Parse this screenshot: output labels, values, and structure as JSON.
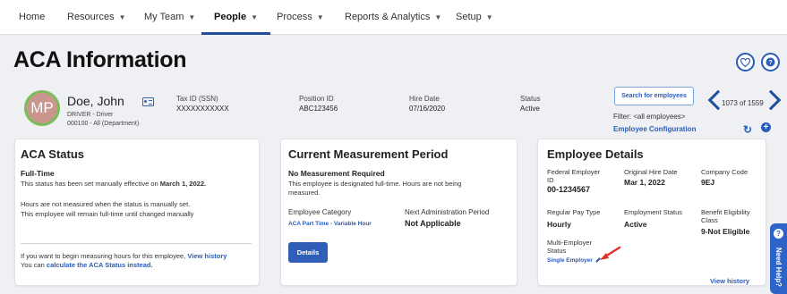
{
  "nav": [
    {
      "label": "Home",
      "caret": false,
      "active": false
    },
    {
      "label": "Resources",
      "caret": true,
      "active": false
    },
    {
      "label": "My Team",
      "caret": true,
      "active": false
    },
    {
      "label": "People",
      "caret": true,
      "active": true
    },
    {
      "label": "Process",
      "caret": true,
      "active": false
    },
    {
      "label": "Reports & Analytics",
      "caret": true,
      "active": false
    },
    {
      "label": "Setup",
      "caret": true,
      "active": false
    }
  ],
  "page_title": "ACA Information",
  "header_icons": {
    "favorite": "heart-icon",
    "help": "help-icon"
  },
  "employee": {
    "initials": "MP",
    "name": "Doe, John",
    "title": "DRIVER - Driver",
    "department": "000100 - All (Department)",
    "tax_id_label": "Tax ID (SSN)",
    "tax_id": "XXXXXXXXXXX",
    "position_id_label": "Position ID",
    "position_id": "ABC123456",
    "hire_date_label": "Hire Date",
    "hire_date": "07/16/2020",
    "status_label": "Status",
    "status": "Active"
  },
  "search": {
    "button_label": "Search for employees",
    "filter_text": "Filter: <all employees>",
    "config_link": "Employee Configuration",
    "counter": "1073 of 1559"
  },
  "aca_status": {
    "title": "ACA Status",
    "status": "Full-Time",
    "set_text_prefix": "This status has been set manually effective on ",
    "set_date": "March 1, 2022.",
    "line1": "Hours are not measured when the status is manually set.",
    "line2": "This employee will remain full-time until changed manually",
    "footer_text": "If you want to begin measuring hours for this employee,",
    "view_history": "View history",
    "footer2_prefix": "You can ",
    "calc_link": "calculate the ACA Status instead."
  },
  "measurement": {
    "title": "Current Measurement Period",
    "heading": "No Measurement Required",
    "desc1": "This employee is designated full-time. Hours are not being",
    "desc2": "measured.",
    "category_label": "Employee Category",
    "category_value": "ACA Part Time - Variable Hour",
    "next_period_label": "Next Administration Period",
    "next_period_value": "Not Applicable",
    "details_button": "Details"
  },
  "employee_details": {
    "title": "Employee Details",
    "fein_label_1": "Federal Employer",
    "fein_label_2": "ID",
    "fein_value": "00-1234567",
    "orig_hire_label": "Original Hire Date",
    "orig_hire_value": "Mar 1, 2022",
    "company_code_label": "Company Code",
    "company_code_value": "9EJ",
    "pay_type_label": "Regular Pay Type",
    "pay_type_value": "Hourly",
    "emp_status_label": "Employment Status",
    "emp_status_value": "Active",
    "benefit_label_1": "Benefit Eligibility",
    "benefit_label_2": "Class",
    "benefit_value": "9-Not Eligible",
    "multi_label_1": "Multi-Employer",
    "multi_label_2": "Status",
    "multi_value": "Single Employer",
    "view_history": "View history"
  },
  "help_tab": {
    "label": "Need Help?"
  },
  "colors": {
    "accent": "#2b5cb8",
    "avatar_ring": "#7bbd5a",
    "arrow": "#e0342e"
  }
}
